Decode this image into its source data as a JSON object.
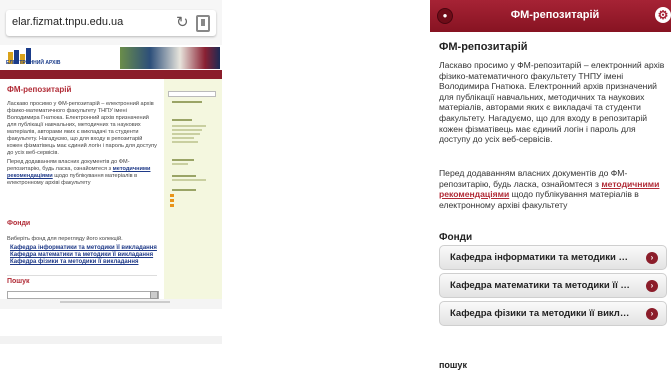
{
  "left": {
    "url": "elar.fizmat.tnpu.edu.ua",
    "logo_text": "ЕЛЕКТРОННИЙ АРХІВ",
    "page_title": "ФМ-репозитарій",
    "body": "Ласкаво просимо у ФМ-репозитарій – електронний архів фізико-математичного факультету ТНПУ імені Володимира Гнатюка. Електронний архів призначений для публікації навчальних, методичних та наукових матеріалів, авторами яких є викладачі та студенти факультету. Нагадуємо, що для входу в репозитарій кожен фізматівець має єдиний логін і пароль для доступу до усіх веб-сервісів.",
    "body2_before": "Перед додаванням власних документів до ФМ-репозитарію, будь ласка, ознайомтеся з ",
    "body2_link": "методичними рекомендаціями",
    "body2_after": " щодо публікування матеріалів в електронному архіві факультету",
    "fonds_title": "Фонди",
    "fonds_intro": "Виберіть фонд для перегляду його колекцій.",
    "fonds": [
      "Кафедра інформатики та методики її викладання",
      "Кафедра математики та методики її викладання",
      "Кафедра фізики та методики її викладання"
    ],
    "search_title": "Пошук"
  },
  "right": {
    "header_title": "ФМ-репозитарій",
    "heading": "ФМ-репозитарій",
    "para1": "Ласкаво просимо у ФМ-репозитарій – електронний архів фізико-математичного факультету ТНПУ імені Володимира Гнатюка. Електронний архів призначений для публікації навчальних, методичних та наукових матеріалів, авторами яких є викладачі та студенти факультету. Нагадуємо, що для входу в репозитарій кожен фізматівець має єдиний логін і пароль для доступу до усіх веб-сервісів.",
    "para2_before": "Перед додаванням власних документів до ФМ-репозитарію, будь ласка, ознайомтеся з ",
    "para2_link": "методичними рекомендаціями",
    "para2_after": " щодо публікування матеріалів в електронному архіві факультету",
    "fonds_title": "Фонди",
    "fonds": [
      "Кафедра інформатики та методики її викладання",
      "Кафедра математики та методики її викладання",
      "Кафедра фізики та методики її викладання"
    ],
    "search_title": "пошук"
  },
  "colors": {
    "brand_red": "#8b1d2a",
    "title_red": "#b12b36",
    "link_blue": "#1f3a88",
    "sidebar_green": "#f4f7df"
  }
}
